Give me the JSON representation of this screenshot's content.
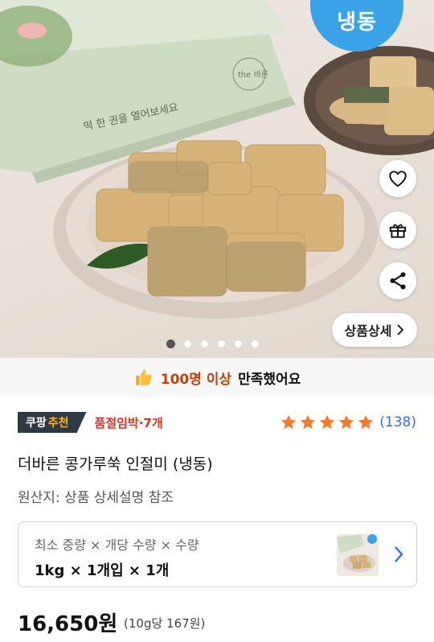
{
  "hero": {
    "frozen_badge": "냉동",
    "box_text": "떡 한 권을 열어보세요",
    "box_brand": "the 바른",
    "detail_button": "상품상세",
    "dots": {
      "count": 6,
      "active_index": 0
    }
  },
  "satisfaction": {
    "highlight": "100명 이상",
    "text": "만족했어요"
  },
  "badges": {
    "coupang_main": "쿠팡",
    "coupang_accent": "추천",
    "soldout": "품절임박·7개"
  },
  "rating": {
    "stars": 5,
    "review_count": "(138)",
    "star_color": "#f57c2a"
  },
  "product": {
    "title": "더바른 콩가루쑥 인절미 (냉동)",
    "origin": "원산지: 상품 상세설명 참조"
  },
  "option": {
    "label": "최소 중량 × 개당 수량 × 수량",
    "value": "1kg × 1개입 × 1개"
  },
  "price": {
    "value": "16,650원",
    "unit": "(10g당 167원)"
  },
  "colors": {
    "accent_blue": "#346aff",
    "frozen_blue": "#3aa3e8",
    "soldout_red": "#d93025",
    "highlight_orange": "#c2410c"
  },
  "icons": [
    "heart-icon",
    "gift-icon",
    "share-icon",
    "chevron-right-icon",
    "thumbs-up-icon",
    "star-icon"
  ]
}
